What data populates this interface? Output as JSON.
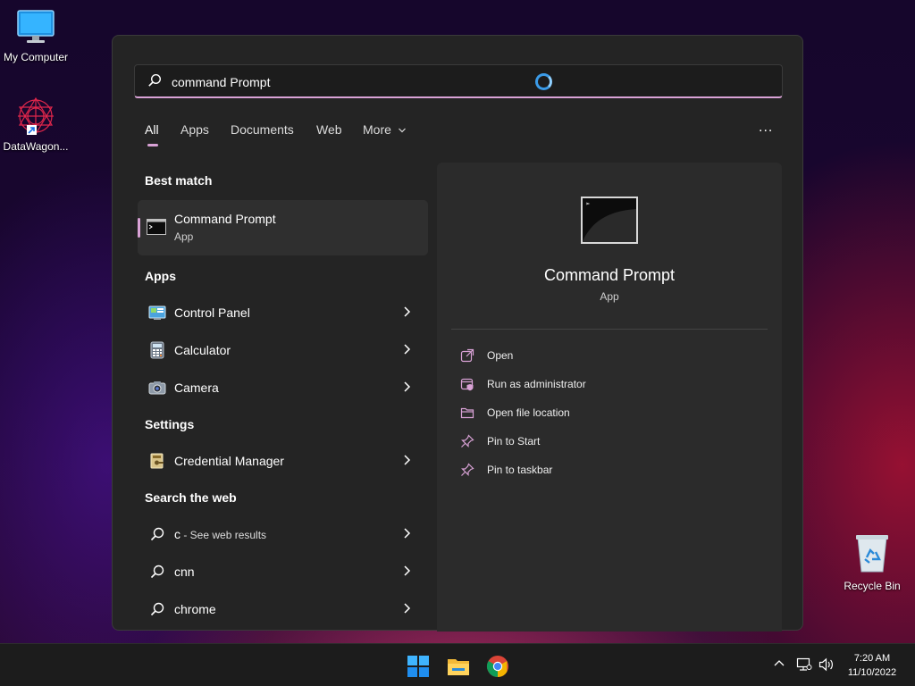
{
  "desktop": {
    "icons": [
      {
        "label": "My Computer",
        "icon": "monitor-icon"
      },
      {
        "label": "DataWagon...",
        "icon": "datawagon-shortcut-icon"
      }
    ],
    "recycle_bin": {
      "label": "Recycle Bin",
      "icon": "recycle-bin-icon"
    }
  },
  "search": {
    "query": "command Prompt",
    "icon": "search-icon"
  },
  "tabs": [
    {
      "label": "All",
      "active": true
    },
    {
      "label": "Apps"
    },
    {
      "label": "Documents"
    },
    {
      "label": "Web"
    },
    {
      "label": "More"
    }
  ],
  "more_options_label": "...",
  "best_match": {
    "heading": "Best match",
    "title": "Command Prompt",
    "subtitle": "App",
    "icon": "command-prompt-icon"
  },
  "apps": {
    "heading": "Apps",
    "items": [
      {
        "label": "Control Panel",
        "icon": "control-panel-icon"
      },
      {
        "label": "Calculator",
        "icon": "calculator-icon"
      },
      {
        "label": "Camera",
        "icon": "camera-icon"
      }
    ]
  },
  "settings": {
    "heading": "Settings",
    "items": [
      {
        "label": "Credential Manager",
        "icon": "credential-manager-icon"
      }
    ]
  },
  "web": {
    "heading": "Search the web",
    "items": [
      {
        "label": "c",
        "suffix": " - See web results"
      },
      {
        "label": "cnn"
      },
      {
        "label": "chrome"
      }
    ]
  },
  "preview": {
    "title": "Command Prompt",
    "subtitle": "App",
    "actions": [
      {
        "label": "Open",
        "icon": "open-icon"
      },
      {
        "label": "Run as administrator",
        "icon": "run-as-admin-icon"
      },
      {
        "label": "Open file location",
        "icon": "folder-icon"
      },
      {
        "label": "Pin to Start",
        "icon": "pin-icon"
      },
      {
        "label": "Pin to taskbar",
        "icon": "pin-icon"
      }
    ]
  },
  "taskbar": {
    "apps": [
      "windows-start-icon",
      "file-explorer-icon",
      "chrome-icon"
    ],
    "tray": [
      "chevron-up-icon",
      "network-icon",
      "volume-icon"
    ],
    "time": "7:20 AM",
    "date": "11/10/2022"
  },
  "colors": {
    "accent": "#d9a2d6",
    "panel": "#242424",
    "preview_panel": "#2b2b2b"
  }
}
